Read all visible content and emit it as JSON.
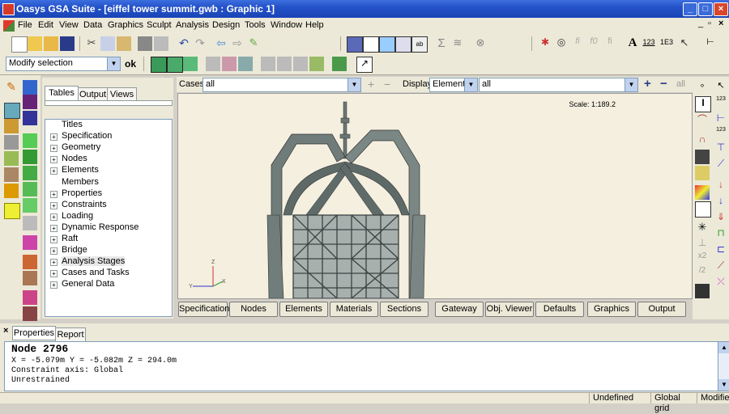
{
  "window": {
    "title": "Oasys GSA Suite - [eiffel tower summit.gwb : Graphic 1]"
  },
  "menu": [
    "File",
    "Edit",
    "View",
    "Data",
    "Graphics",
    "Sculpt",
    "Analysis",
    "Design",
    "Tools",
    "Window",
    "Help"
  ],
  "selection": {
    "mode": "Modify selection",
    "ok_label": "ok"
  },
  "cases": {
    "label": "Cases",
    "value": "all"
  },
  "display": {
    "label": "Display",
    "type": "Elements",
    "value": "all",
    "all_label": "all"
  },
  "tree_tabs": [
    "Tables",
    "Output",
    "Views"
  ],
  "tree_items": [
    {
      "label": "Titles",
      "expandable": false
    },
    {
      "label": "Specification",
      "expandable": true
    },
    {
      "label": "Geometry",
      "expandable": true
    },
    {
      "label": "Nodes",
      "expandable": true
    },
    {
      "label": "Elements",
      "expandable": true
    },
    {
      "label": "Members",
      "expandable": false
    },
    {
      "label": "Properties",
      "expandable": true
    },
    {
      "label": "Constraints",
      "expandable": true
    },
    {
      "label": "Loading",
      "expandable": true
    },
    {
      "label": "Dynamic Response",
      "expandable": true
    },
    {
      "label": "Raft",
      "expandable": true
    },
    {
      "label": "Bridge",
      "expandable": true
    },
    {
      "label": "Analysis Stages",
      "expandable": true,
      "selected": true
    },
    {
      "label": "Cases and Tasks",
      "expandable": true
    },
    {
      "label": "General Data",
      "expandable": true
    }
  ],
  "graphic": {
    "scale": "Scale: 1:189.2",
    "axis_x": "X",
    "axis_y": "Y",
    "axis_z": "Z"
  },
  "graphic_buttons": [
    "Specification",
    "Nodes",
    "Elements",
    "Materials",
    "Sections",
    "Gateway",
    "Obj. Viewer",
    "Defaults",
    "Graphics",
    "Output"
  ],
  "properties": {
    "tabs": [
      "Properties",
      "Report"
    ],
    "lines": [
      "Node 2796",
      "X = -5.079m   Y = -5.082m   Z = 294.0m",
      "Constraint axis: Global",
      "Unrestrained"
    ]
  },
  "status": [
    "Undefined",
    "Global grid",
    "Modified"
  ],
  "toolbar_labels": {
    "calc": "Σ",
    "text_a": "A",
    "val_123": "123",
    "val_1e3": "1E3",
    "val_2": "2",
    "val_x2": "x2",
    "val_r2": "/2"
  }
}
